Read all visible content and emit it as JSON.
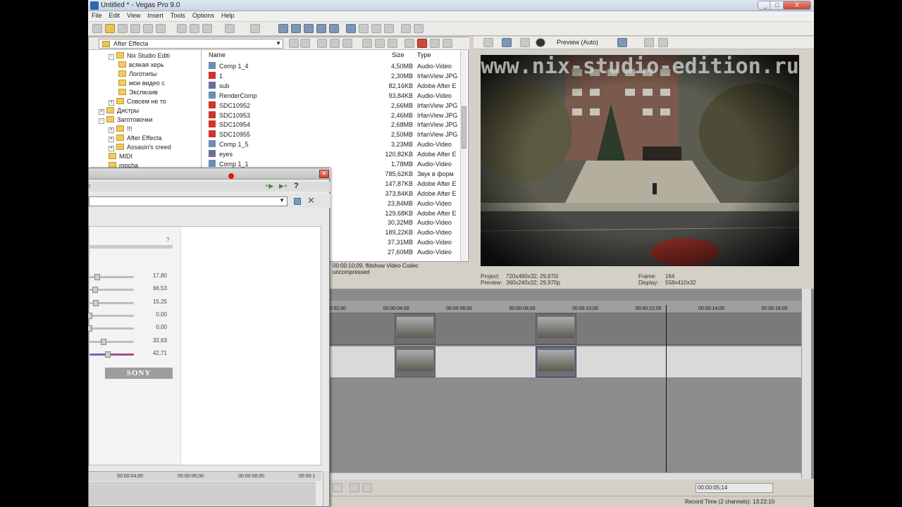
{
  "window": {
    "title": "Untitled * - Vegas Pro 9.0",
    "min": "_",
    "max": "□",
    "close": "X"
  },
  "menu": [
    "File",
    "Edit",
    "View",
    "Insert",
    "Tools",
    "Options",
    "Help"
  ],
  "explorer": {
    "path": "After Effecta",
    "tree": [
      {
        "label": "Nix Studio Editi",
        "indent": 2,
        "exp": "-"
      },
      {
        "label": "всякая херь",
        "indent": 3,
        "exp": ""
      },
      {
        "label": "Логотипы",
        "indent": 3,
        "exp": ""
      },
      {
        "label": "мои видео с",
        "indent": 3,
        "exp": ""
      },
      {
        "label": "Экслюзив",
        "indent": 3,
        "exp": ""
      },
      {
        "label": "Совсем не то",
        "indent": 2,
        "exp": "+"
      },
      {
        "label": "Дистры",
        "indent": 1,
        "exp": "+"
      },
      {
        "label": "Заготовочки",
        "indent": 1,
        "exp": "-"
      },
      {
        "label": "!!!",
        "indent": 2,
        "exp": "+"
      },
      {
        "label": "After Effecta",
        "indent": 2,
        "exp": "+"
      },
      {
        "label": "Assasin's creed",
        "indent": 2,
        "exp": "+"
      },
      {
        "label": "MIDI",
        "indent": 2,
        "exp": ""
      },
      {
        "label": "mocha",
        "indent": 2,
        "exp": ""
      }
    ],
    "columns": {
      "name": "Name",
      "size": "Size",
      "type": "Type"
    },
    "files": [
      {
        "name": "Comp 1_4",
        "size": "4,50MB",
        "type": "Audio-Video",
        "icon": "video-file-icon"
      },
      {
        "name": "1",
        "size": "2,30MB",
        "type": "IrfanView JPG",
        "icon": "image-file-icon"
      },
      {
        "name": "sub",
        "size": "82,16KB",
        "type": "Adobe After E",
        "icon": "project-file-icon"
      },
      {
        "name": "RenderComp",
        "size": "93,84KB",
        "type": "Audio-Video",
        "icon": "video-file-icon"
      },
      {
        "name": "SDC10952",
        "size": "2,66MB",
        "type": "IrfanView JPG",
        "icon": "image-file-icon"
      },
      {
        "name": "SDC10953",
        "size": "2,46MB",
        "type": "IrfanView JPG",
        "icon": "image-file-icon"
      },
      {
        "name": "SDC10954",
        "size": "2,68MB",
        "type": "IrfanView JPG",
        "icon": "image-file-icon"
      },
      {
        "name": "SDC10955",
        "size": "2,50MB",
        "type": "IrfanView JPG",
        "icon": "image-file-icon"
      },
      {
        "name": "Comp 1_5",
        "size": "3,23MB",
        "type": "Audio-Video",
        "icon": "video-file-icon"
      },
      {
        "name": "eyes",
        "size": "120,82KB",
        "type": "Adobe After E",
        "icon": "project-file-icon"
      },
      {
        "name": "Comp 1_1",
        "size": "1,78MB",
        "type": "Audio-Video",
        "icon": "video-file-icon"
      },
      {
        "name": "",
        "size": "785,62KB",
        "type": "Звук в форм",
        "icon": "audio-file-icon"
      },
      {
        "name": "",
        "size": "147,87KB",
        "type": "Adobe After E",
        "icon": "project-file-icon"
      },
      {
        "name": "",
        "size": "373,84KB",
        "type": "Adobe After E",
        "icon": "project-file-icon"
      },
      {
        "name": "",
        "size": "23,84MB",
        "type": "Audio-Video",
        "icon": "video-file-icon"
      },
      {
        "name": "",
        "size": "129,68KB",
        "type": "Adobe After E",
        "icon": "project-file-icon"
      },
      {
        "name": "",
        "size": "30,32MB",
        "type": "Audio-Video",
        "icon": "video-file-icon"
      },
      {
        "name": "",
        "size": "189,22KB",
        "type": "Audio-Video",
        "icon": "video-file-icon"
      },
      {
        "name": "",
        "size": "37,31MB",
        "type": "Audio-Video",
        "icon": "video-file-icon"
      },
      {
        "name": "",
        "size": "27,60MB",
        "type": "Audio-Video",
        "icon": "video-file-icon"
      }
    ],
    "info_line1": "00:00:10;09, ffdshow Video Codec",
    "info_line2": "uncompressed"
  },
  "preview": {
    "mode": "Preview (Auto)",
    "watermark": "www.nix-studio-edition.ru",
    "project_label": "Project:",
    "project_value": "720x480x32; 29,970i",
    "preview_label": "Preview:",
    "preview_value": "360x240x32; 29,970p",
    "frame_label": "Frame:",
    "frame_value": "164",
    "display_label": "Display:",
    "display_value": "558x410x32"
  },
  "plugin": {
    "help": "?",
    "help2": "?",
    "tab_fragment": "t",
    "sliders": [
      {
        "value": "17,80",
        "fill": 0.17
      },
      {
        "value": "66,53",
        "fill": 0.13
      },
      {
        "value": "15,25",
        "fill": 0.15
      },
      {
        "value": "0,00",
        "fill": 0.0
      },
      {
        "value": "0,00",
        "fill": 0.0
      },
      {
        "value": "32,63",
        "fill": 0.32
      },
      {
        "value": "42,71",
        "fill": 0.42
      }
    ],
    "brand": "SONY",
    "ruler": [
      "00:00:04;00",
      "00:00:06;00",
      "00:00:08;00",
      "00:00:1"
    ]
  },
  "timeline": {
    "ruler": [
      "00:00:02;00",
      "00:00:04;00",
      "00:00:06;00",
      "00:00:08;00",
      "00:00:10;00",
      "00:00:12;00",
      "00:00:14;00",
      "00:00:16;00"
    ],
    "timecode": "00:00:05;14",
    "status": "Record Time (2 channels): 13:22:10"
  }
}
